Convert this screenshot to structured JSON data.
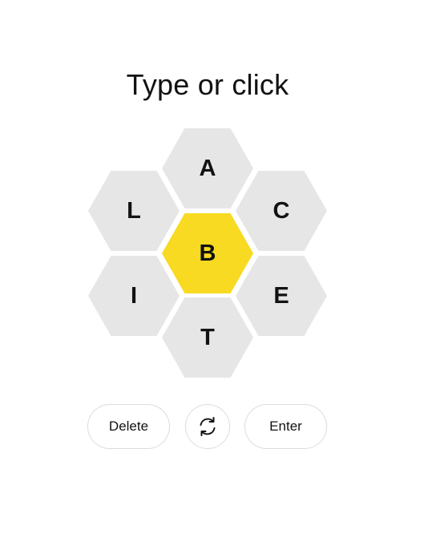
{
  "prompt": "Type or click",
  "hive": {
    "center_letter": "B",
    "outer_letters": {
      "top": "A",
      "upper_left": "L",
      "upper_right": "C",
      "lower_left": "I",
      "lower_right": "E",
      "bottom": "T"
    }
  },
  "controls": {
    "delete_label": "Delete",
    "shuffle_icon": "shuffle-icon",
    "enter_label": "Enter"
  },
  "colors": {
    "center_hex": "#f7da21",
    "outer_hex": "#e6e6e6",
    "text": "#121212",
    "button_border": "#dcdcdc"
  }
}
